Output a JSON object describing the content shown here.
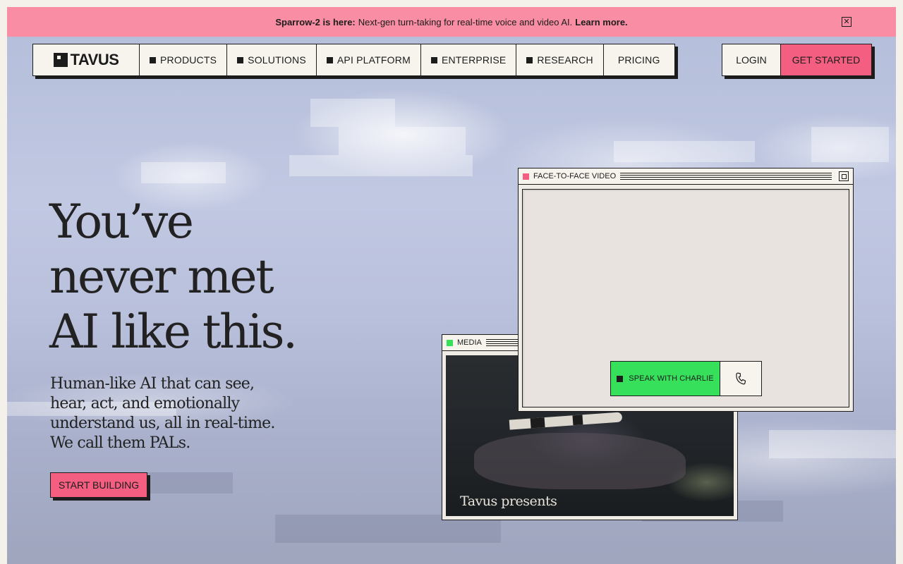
{
  "announcement": {
    "bold": "Sparrow-2 is here:",
    "text": "Next-gen turn-taking for real-time voice and video AI.",
    "link": "Learn more.",
    "close_icon": "close-icon"
  },
  "nav": {
    "logo_text": "TAVUS",
    "items": [
      {
        "label": "PRODUCTS"
      },
      {
        "label": "SOLUTIONS"
      },
      {
        "label": "API PLATFORM"
      },
      {
        "label": "ENTERPRISE"
      },
      {
        "label": "RESEARCH"
      },
      {
        "label": "PRICING"
      }
    ],
    "login": "LOGIN",
    "get_started": "GET STARTED"
  },
  "hero": {
    "title_lines": [
      "You’ve",
      "never met",
      "AI like this."
    ],
    "subtitle": "Human-like AI that can see, hear, act, and emotionally understand us, all in real-time. We call them PALs.",
    "cta": "START BUILDING"
  },
  "media_window": {
    "title": "MEDIA",
    "caption": "Tavus presents",
    "dot_color": "#36e05a"
  },
  "video_window": {
    "title": "FACE-TO-FACE VIDEO",
    "dot_color": "#f45f81",
    "speak_label": "SPEAK WITH CHARLIE",
    "phone_icon": "phone-icon"
  },
  "colors": {
    "accent_pink": "#f45f81",
    "banner_pink": "#f88da3",
    "accent_green": "#36e05a",
    "ink": "#1c1c1c"
  }
}
